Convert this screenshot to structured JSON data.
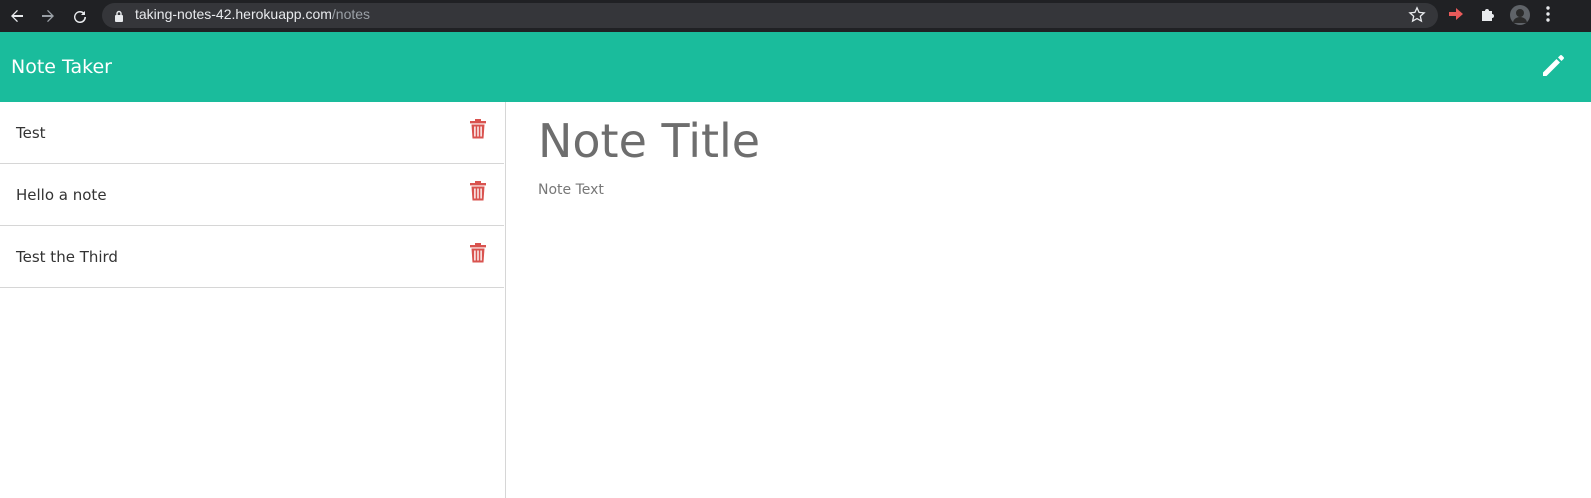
{
  "browser": {
    "url_host": "taking-notes-42.herokuapp.com",
    "url_path": "/notes"
  },
  "app": {
    "brand": "Note Taker",
    "accent_color": "#1abc9c",
    "delete_color": "#d9534f"
  },
  "notes": [
    {
      "title": "Test"
    },
    {
      "title": "Hello a note"
    },
    {
      "title": "Test the Third"
    }
  ],
  "editor": {
    "title_placeholder": "Note Title",
    "text_placeholder": "Note Text"
  },
  "icons": {
    "new_note": "pencil-icon",
    "delete": "trash-icon"
  }
}
